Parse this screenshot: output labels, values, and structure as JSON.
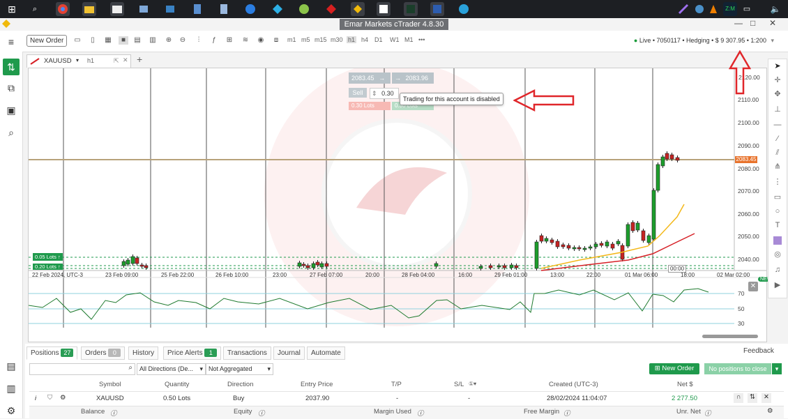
{
  "window": {
    "title": "Emar Markets cTrader 4.8.30"
  },
  "taskbar": {
    "tray_text": "Z:M"
  },
  "toolbar": {
    "new_order_label": "New Order",
    "timeframes": [
      "m1",
      "m5",
      "m15",
      "m30",
      "h1",
      "h4",
      "D1",
      "W1",
      "M1"
    ],
    "more_label": "•••"
  },
  "account": {
    "text": "Live • 7050117 • Hedging • $ 9 307.95 • 1:200"
  },
  "chart_tab": {
    "symbol": "XAUUSD",
    "timeframe": "h1"
  },
  "trade_panel": {
    "bid": "2083.45",
    "ask": "2083.96",
    "sell_label": "Sell",
    "quantity": "0.30",
    "sell_lots": "0.30 Lots",
    "buy_lots": "0.30 Lots",
    "tooltip": "Trading for this account is disabled"
  },
  "chart": {
    "price_ticks": [
      "2110.00",
      "2100.00",
      "2090.00",
      "2080.00",
      "2070.00",
      "2060.00",
      "2050.00",
      "2040.00"
    ],
    "price_top_label": "2120.00",
    "current_price": "2083.45",
    "time_labels": [
      "22 Feb 2024, UTC-3",
      "23 Feb 09:00",
      "25 Feb 22:00",
      "26 Feb 10:00",
      "23:00",
      "27 Feb 07:00",
      "20:00",
      "28 Feb 04:00",
      "16:00",
      "29 Feb 01:00",
      "13:00",
      "22:00",
      "01 Mar 06:00",
      "18:00",
      "02 Mar 02:00"
    ],
    "countdown": "00:00",
    "lots_labels": [
      "0.05 Lots",
      "0.20 Lots"
    ],
    "indicator_ticks": [
      "70",
      "50",
      "30"
    ],
    "new_badge": "NEW"
  },
  "bottom": {
    "tabs": [
      {
        "label": "Positions",
        "count": "27",
        "active": true
      },
      {
        "label": "Orders",
        "count": "0"
      },
      {
        "label": "History"
      },
      {
        "label": "Price Alerts",
        "count": "1"
      },
      {
        "label": "Transactions"
      },
      {
        "label": "Journal"
      },
      {
        "label": "Automate"
      }
    ],
    "feedback_label": "Feedback",
    "filter_direction": "All Directions (De...",
    "filter_aggregate": "Not Aggregated",
    "new_order_label": "New Order",
    "close_label": "No positions to close",
    "columns": [
      "Symbol",
      "Quantity",
      "Direction",
      "Entry Price",
      "T/P",
      "S/L",
      "Created (UTC-3)",
      "Net $"
    ],
    "row": {
      "symbol": "XAUUSD",
      "quantity": "0.50 Lots",
      "direction": "Buy",
      "entry": "2037.90",
      "tp": "-",
      "sl": "-",
      "created": "28/02/2024 11:04:07",
      "net": "2 277.50"
    },
    "summary": [
      "Balance",
      "Equity",
      "Margin Used",
      "Free Margin",
      "Unr. Net"
    ]
  },
  "colors": {
    "accent_green": "#1f9a4c",
    "annotation_red": "#e0262a",
    "price_line": "#b7a27a",
    "ma_red": "#d61f25",
    "ma_yellow": "#f3b81a"
  }
}
